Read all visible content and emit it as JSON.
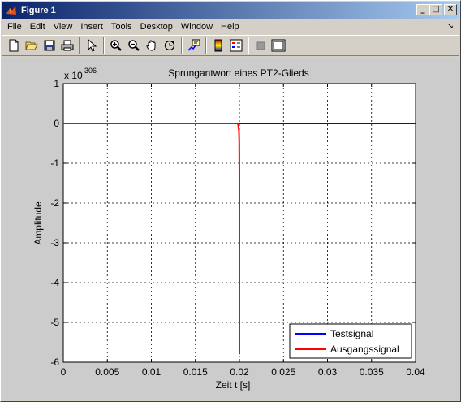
{
  "window": {
    "title": "Figure 1",
    "minimize_glyph": "_",
    "maximize_glyph": "□",
    "close_glyph": "✕"
  },
  "menu": {
    "items": [
      "File",
      "Edit",
      "View",
      "Insert",
      "Tools",
      "Desktop",
      "Window",
      "Help"
    ],
    "dock_glyph": "↘"
  },
  "toolbar": {
    "icons": [
      "new-figure-icon",
      "open-file-icon",
      "save-icon",
      "print-icon",
      "edit-plot-icon",
      "zoom-in-icon",
      "zoom-out-icon",
      "pan-icon",
      "rotate-3d-icon",
      "data-cursor-icon",
      "insert-colorbar-icon",
      "insert-legend-icon",
      "hide-plot-tools-icon",
      "show-plot-tools-icon"
    ]
  },
  "chart_data": {
    "type": "line",
    "title": "Sprungantwort eines PT2-Glieds",
    "xlabel": "Zeit t [s]",
    "ylabel": "Amplitude",
    "y_exponent_base": "x 10",
    "y_exponent_power": "306",
    "xlim": [
      0,
      0.04
    ],
    "ylim": [
      -6,
      1
    ],
    "x_ticks": [
      0,
      0.005,
      0.01,
      0.015,
      0.02,
      0.025,
      0.03,
      0.035,
      0.04
    ],
    "x_tick_labels": [
      "0",
      "0.005",
      "0.01",
      "0.015",
      "0.02",
      "0.025",
      "0.03",
      "0.035",
      "0.04"
    ],
    "y_ticks": [
      1,
      0,
      -1,
      -2,
      -3,
      -4,
      -5,
      -6
    ],
    "y_tick_labels": [
      "1",
      "0",
      "-1",
      "-2",
      "-3",
      "-4",
      "-5",
      "-6"
    ],
    "grid": true,
    "grid_style": "dashed",
    "legend_position": "bottom-right",
    "series": [
      {
        "name": "Testsignal",
        "color": "#0000ff",
        "x": [
          0,
          0.02,
          0.04
        ],
        "y": [
          0,
          0,
          0
        ]
      },
      {
        "name": "Ausgangssignal",
        "color": "#ff0000",
        "x": [
          0,
          0.0197,
          0.01985,
          0.0199,
          0.01995,
          0.01998,
          0.02,
          0.02
        ],
        "y": [
          0,
          0,
          -0.02,
          -0.1,
          -0.2,
          -0.5,
          -1.3,
          -5.8
        ]
      }
    ]
  }
}
